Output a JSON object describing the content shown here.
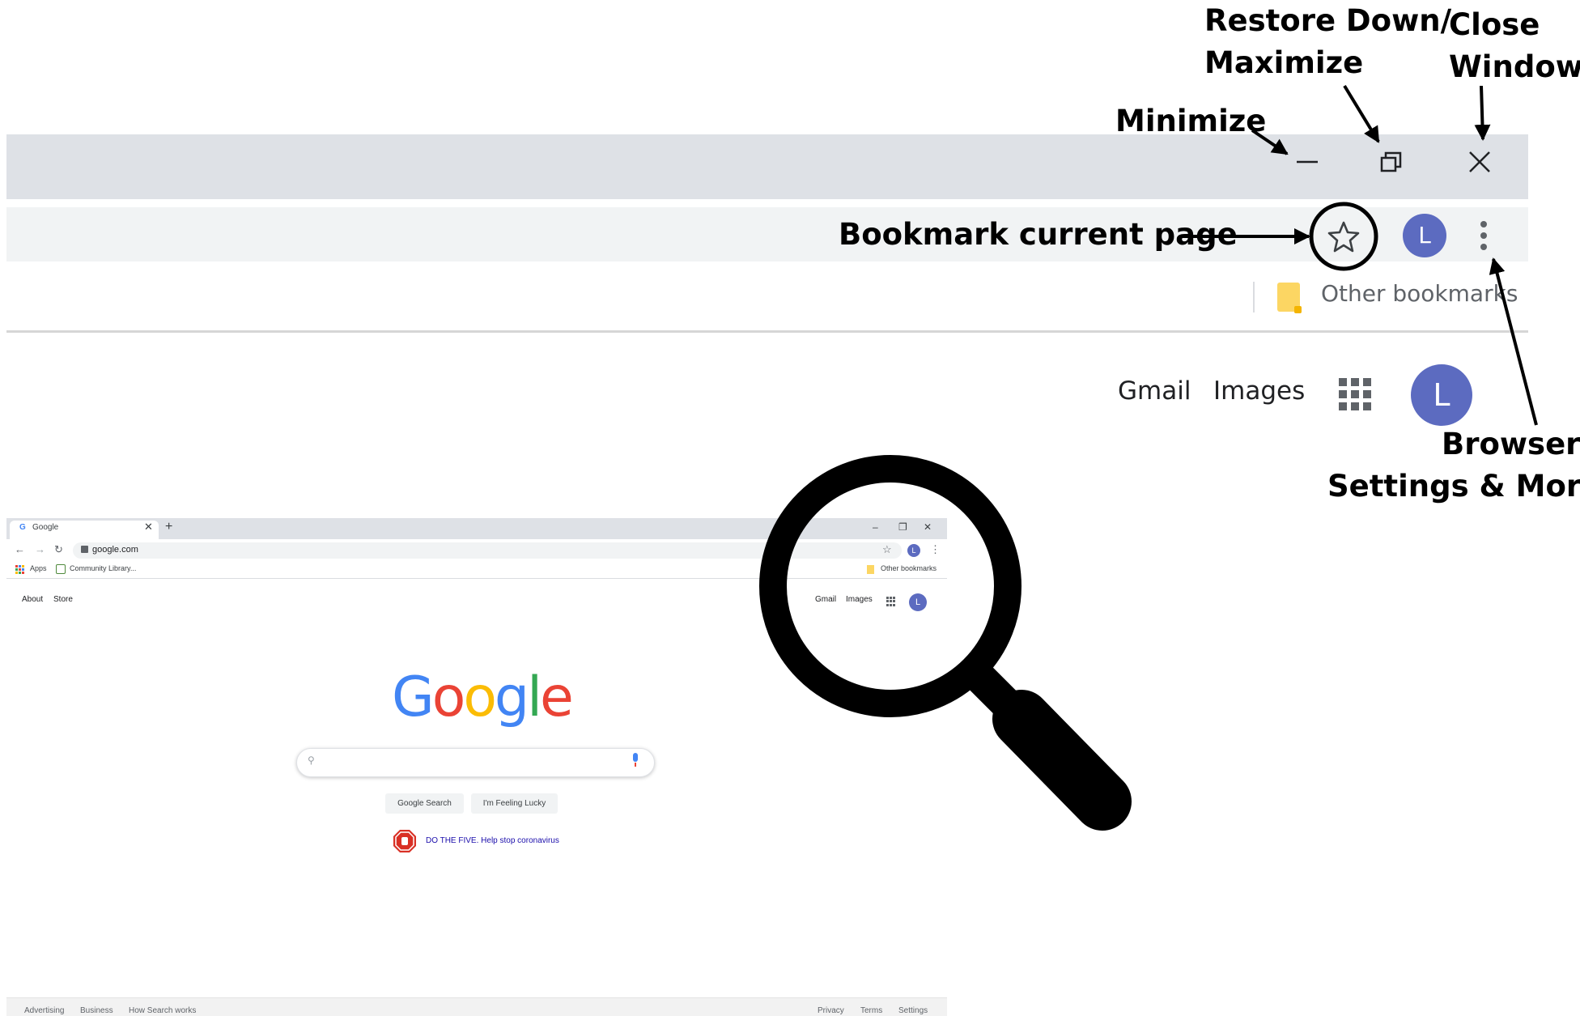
{
  "annotations": {
    "restore_line1": "Restore Down/",
    "restore_line2": "Maximize",
    "close_line1": "Close",
    "close_line2": "Window",
    "minimize": "Minimize",
    "bookmark": "Bookmark current page",
    "settings_line1": "Browser",
    "settings_line2": "Settings & More"
  },
  "zoomed": {
    "profile_initial": "L",
    "other_bookmarks": "Other bookmarks",
    "gmail": "Gmail",
    "images": "Images",
    "account_initial": "L"
  },
  "mini": {
    "tab_title": "Google",
    "url": "google.com",
    "bookmarks": {
      "apps": "Apps",
      "community": "Community Library...",
      "other": "Other bookmarks"
    },
    "header_links": {
      "about": "About",
      "store": "Store",
      "gmail": "Gmail",
      "images": "Images"
    },
    "profile_initial": "L",
    "account_initial": "L",
    "logo": [
      "G",
      "o",
      "o",
      "g",
      "l",
      "e"
    ],
    "buttons": {
      "search": "Google Search",
      "lucky": "I'm Feeling Lucky"
    },
    "promo": "DO THE FIVE. Help stop coronavirus",
    "footer": {
      "advertising": "Advertising",
      "business": "Business",
      "how": "How Search works",
      "privacy": "Privacy",
      "terms": "Terms",
      "settings": "Settings"
    }
  },
  "colors": {
    "titlebar": "#dee1e6",
    "toolbar": "#f1f3f4",
    "avatar": "#5c6bc0",
    "google_blue": "#4285f4",
    "google_red": "#ea4335",
    "google_yellow": "#fbbc05",
    "google_green": "#34a853",
    "folder": "#fcd663"
  },
  "icons": [
    "minimize-icon",
    "restore-icon",
    "close-icon",
    "star-icon",
    "menu-icon",
    "apps-grid-icon",
    "folder-icon",
    "magnifier-icon",
    "search-icon",
    "mic-icon",
    "stop-sign-icon",
    "back-icon",
    "forward-icon",
    "reload-icon",
    "lock-icon"
  ]
}
